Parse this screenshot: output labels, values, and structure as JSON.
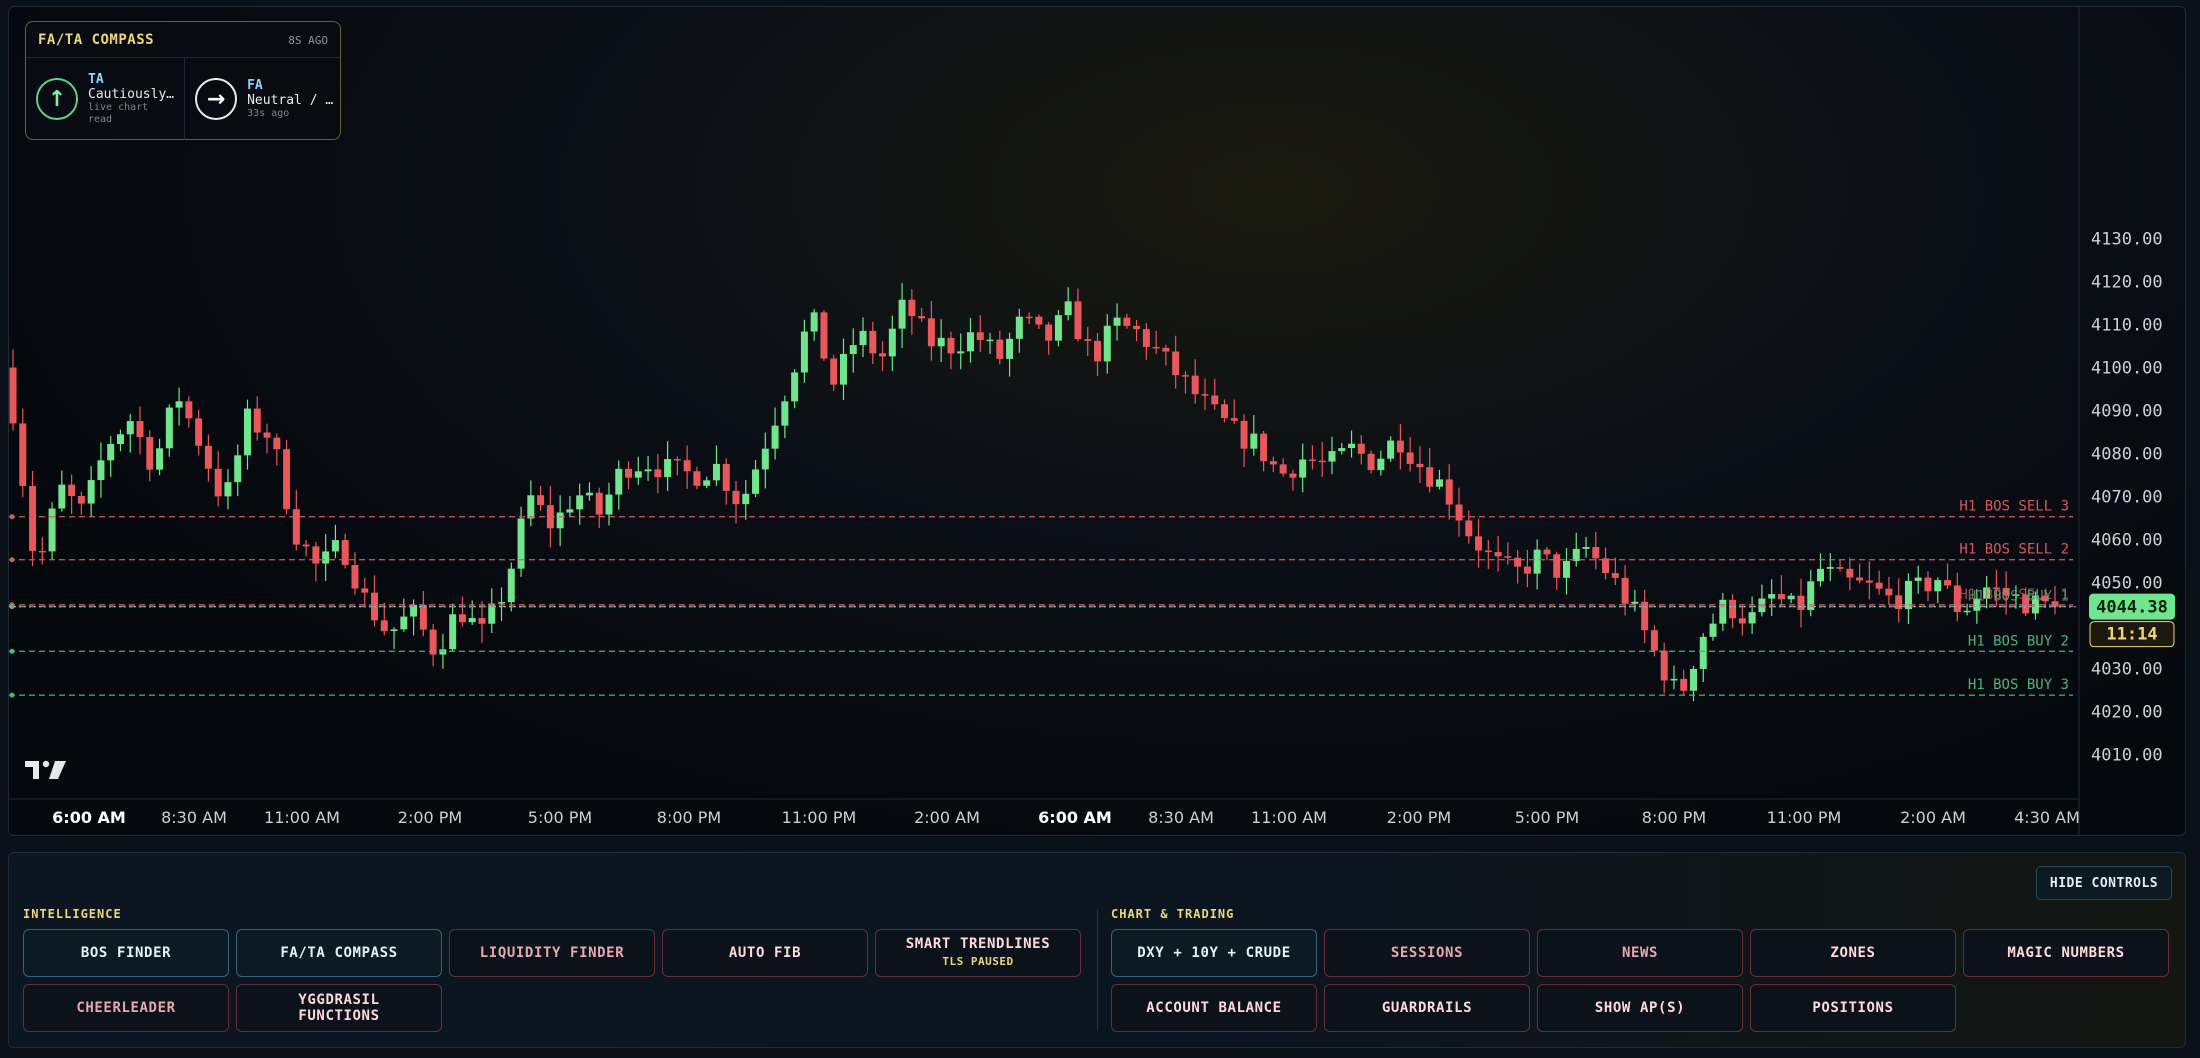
{
  "compass": {
    "title": "FA/TA COMPASS",
    "age": "8S AGO",
    "ta": {
      "label": "TA",
      "value": "Cautiously…",
      "note": "live chart read",
      "icon": "arrow-up-icon"
    },
    "fa": {
      "label": "FA",
      "value": "Neutral / …",
      "note": "33s ago",
      "icon": "arrow-right-icon"
    }
  },
  "chart": {
    "price_axis": [
      "4130.00",
      "4120.00",
      "4110.00",
      "4100.00",
      "4090.00",
      "4080.00",
      "4070.00",
      "4060.00",
      "4050.00",
      "4030.00",
      "4020.00",
      "4010.00"
    ],
    "time_axis": [
      "6:00 AM",
      "8:30 AM",
      "11:00 AM",
      "2:00 PM",
      "5:00 PM",
      "8:00 PM",
      "11:00 PM",
      "2:00 AM",
      "6:00 AM",
      "8:30 AM",
      "11:00 AM",
      "2:00 PM",
      "5:00 PM",
      "8:00 PM",
      "11:00 PM",
      "2:00 AM",
      "4:30 AM"
    ],
    "current_price": "4044.38",
    "countdown": "11:14",
    "levels": [
      {
        "label": "H1 BOS SELL 3",
        "price": 4065.3,
        "kind": "sell"
      },
      {
        "label": "H1 BOS SELL 2",
        "price": 4055.3,
        "kind": "sell"
      },
      {
        "label": "H1 BOS SELL 1",
        "price": 4044.8,
        "kind": "sell"
      },
      {
        "label": "H1 BOS BUY 1",
        "price": 4044.4,
        "kind": "buy"
      },
      {
        "label": "H1 BOS BUY 2",
        "price": 4034.0,
        "kind": "buy"
      },
      {
        "label": "H1 BOS BUY 3",
        "price": 4023.8,
        "kind": "buy"
      }
    ],
    "candle_path": [
      4090,
      4052,
      4072,
      4066,
      4082,
      4088,
      4077,
      4094,
      4082,
      4068,
      4088,
      4084,
      4062,
      4053,
      4059,
      4046,
      4038,
      4043,
      4034,
      4044,
      4038,
      4049,
      4070,
      4063,
      4071,
      4066,
      4077,
      4078,
      4076,
      4075,
      4077,
      4068,
      4082,
      4096,
      4112,
      4096,
      4108,
      4102,
      4115,
      4106,
      4105,
      4108,
      4102,
      4111,
      4106,
      4113,
      4102,
      4110,
      4108,
      4102,
      4096,
      4090,
      4085,
      4082,
      4075,
      4079,
      4077,
      4081,
      4078,
      4084,
      4077,
      4072,
      4062,
      4055,
      4052,
      4056,
      4052,
      4058,
      4052,
      4044,
      4033,
      4023,
      4038,
      4045,
      4041,
      4047,
      4043,
      4053,
      4050,
      4049,
      4046,
      4048,
      4051,
      4043,
      4049,
      4047,
      4045,
      4044.38
    ],
    "colors": {
      "up": "#6fe58c",
      "down": "#e8575a",
      "sell_line": "#d75a5f",
      "buy_line": "#49b57f",
      "price_line": "#9fb0bf",
      "price_tag": "#6fe58c",
      "countdown": "#f0d676"
    }
  },
  "controls": {
    "hide_label": "HIDE CONTROLS",
    "intelligence_label": "INTELLIGENCE",
    "chart_trading_label": "CHART & TRADING",
    "intelligence": {
      "bos_finder": "BOS FINDER",
      "fa_ta_compass": "FA/TA COMPASS",
      "liquidity_finder": "LIQUIDITY FINDER",
      "auto_fib": "AUTO FIB",
      "smart_trendlines": "SMART TRENDLINES",
      "smart_trendlines_sub": "TLS PAUSED",
      "cheerleader": "CHEERLEADER",
      "yggdrasil": "YGGDRASIL FUNCTIONS"
    },
    "trading": {
      "dxy": "DXY + 10Y + CRUDE",
      "sessions": "SESSIONS",
      "news": "NEWS",
      "zones": "ZONES",
      "magic_numbers": "MAGIC NUMBERS",
      "account_balance": "ACCOUNT BALANCE",
      "guardrails": "GUARDRAILS",
      "show_aps": "SHOW AP(S)",
      "positions": "POSITIONS"
    }
  }
}
